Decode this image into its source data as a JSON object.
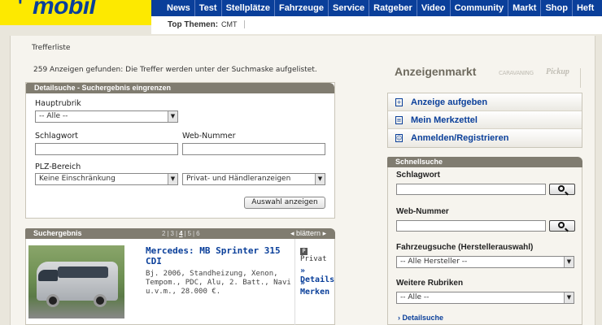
{
  "header": {
    "logo_text": "mobil",
    "logo_quote": "'",
    "nav": [
      "News",
      "Test",
      "Stellplätze",
      "Fahrzeuge",
      "Service",
      "Ratgeber",
      "Video",
      "Community",
      "Markt",
      "Shop",
      "Heft"
    ],
    "topics_label": "Top Themen:",
    "topics": [
      "CMT"
    ]
  },
  "page": {
    "breadcrumb": "Trefferliste",
    "result_count": "259 Anzeigen gefunden: Die Treffer werden unter der Suchmaske aufgelistet."
  },
  "detail_search": {
    "title": "Detailsuche - Suchergebnis eingrenzen",
    "hauptrubrik_label": "Hauptrubrik",
    "hauptrubrik_value": "-- Alle --",
    "schlagwort_label": "Schlagwort",
    "schlagwort_value": "",
    "webnummer_label": "Web-Nummer",
    "webnummer_value": "",
    "plz_label": "PLZ-Bereich",
    "plz_value": "Keine Einschränkung",
    "anbieter_value": "Privat- und Händleranzeigen",
    "submit_label": "Auswahl anzeigen"
  },
  "results": {
    "title": "Suchergebnis",
    "pages": [
      "2",
      "3",
      "4",
      "5",
      "6"
    ],
    "current_page": "4",
    "next_label": "blättern",
    "items": [
      {
        "title": "Mercedes: MB Sprinter 315 CDI",
        "description": "Bj. 2006, Standheizung, Xenon, Tempom., PDC, Alu, 2. Batt., Navi u.v.m., 28.000 €.",
        "seller_type": "Privat",
        "details_label": "» Details",
        "remember_label": "» Merken"
      }
    ]
  },
  "sidebar": {
    "market_title": "Anzeigenmarkt",
    "brand_1": "CARAVANING",
    "brand_2": "Pickup",
    "menu": [
      {
        "label": "Anzeige aufgeben",
        "icon": "plus-icon"
      },
      {
        "label": "Mein Merkzettel",
        "icon": "notes-icon"
      },
      {
        "label": "Anmelden/Registrieren",
        "icon": "user-icon"
      }
    ],
    "quick_search": {
      "title": "Schnellsuche",
      "schlagwort_label": "Schlagwort",
      "webnummer_label": "Web-Nummer",
      "hersteller_label": "Fahrzeugsuche (Herstellerauswahl)",
      "hersteller_value": "-- Alle Hersteller --",
      "rubriken_label": "Weitere Rubriken",
      "rubriken_value": "-- Alle --",
      "more_link": "› Detailsuche"
    }
  },
  "colors": {
    "nav_blue": "#0a3f9a",
    "logo_yellow": "#fde900",
    "panel_header": "#807c70"
  }
}
